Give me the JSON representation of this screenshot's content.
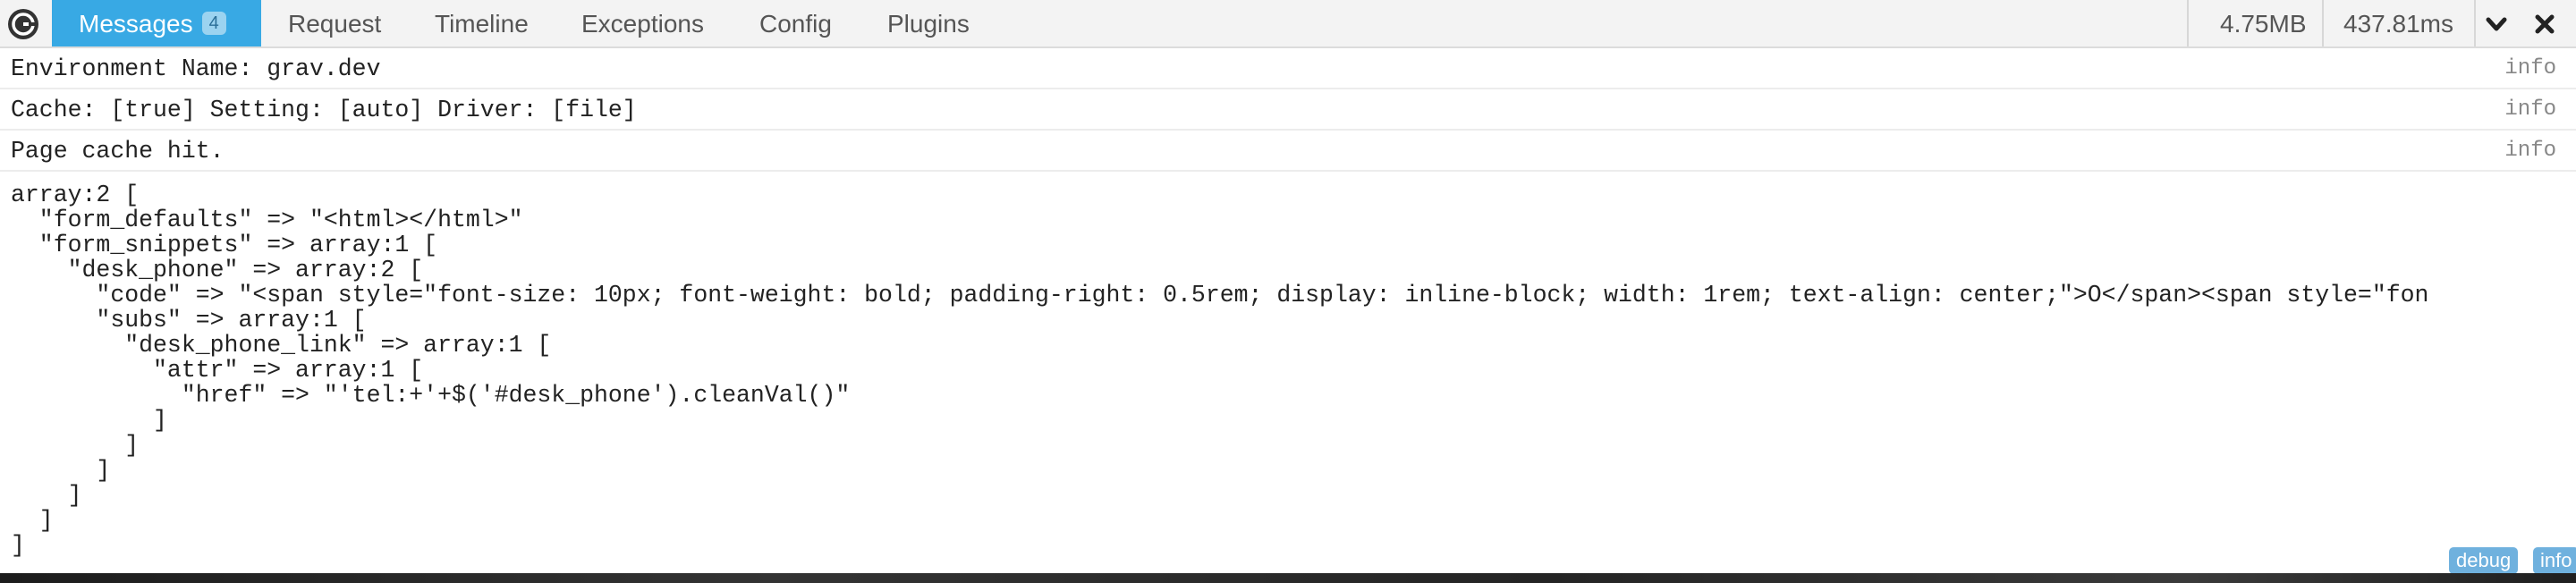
{
  "tabs": [
    {
      "label": "Messages",
      "badge": "4"
    },
    {
      "label": "Request"
    },
    {
      "label": "Timeline"
    },
    {
      "label": "Exceptions"
    },
    {
      "label": "Config"
    },
    {
      "label": "Plugins"
    }
  ],
  "stats": {
    "memory": "4.75MB",
    "time": "437.81ms"
  },
  "icons": {
    "logo": "grav-logo-icon",
    "minimize": "chevron-down-icon",
    "close": "close-icon"
  },
  "messages": [
    {
      "text": "Environment Name: grav.dev",
      "label": "info"
    },
    {
      "text": "Cache: [true] Setting: [auto] Driver: [file]",
      "label": "info"
    },
    {
      "text": "Page cache hit.",
      "label": "info"
    }
  ],
  "dump_lines": [
    "array:2 [",
    "  \"form_defaults\" => \"<html></html>\"",
    "  \"form_snippets\" => array:1 [",
    "    \"desk_phone\" => array:2 [",
    "      \"code\" => \"<span style=\"font-size: 10px; font-weight: bold; padding-right: 0.5rem; display: inline-block; width: 1rem; text-align: center;\">O</span><span style=\"fon",
    "      \"subs\" => array:1 [",
    "        \"desk_phone_link\" => array:1 [",
    "          \"attr\" => array:1 [",
    "            \"href\" => \"'tel:+'+$('#desk_phone').cleanVal()\"",
    "          ]",
    "        ]",
    "      ]",
    "    ]",
    "  ]",
    "]"
  ],
  "filters": [
    {
      "label": "debug"
    },
    {
      "label": "info"
    }
  ],
  "colors": {
    "accent": "#38a9e4",
    "badge_bg": "#9bd3f0",
    "pill_bg": "#6fb1de"
  }
}
